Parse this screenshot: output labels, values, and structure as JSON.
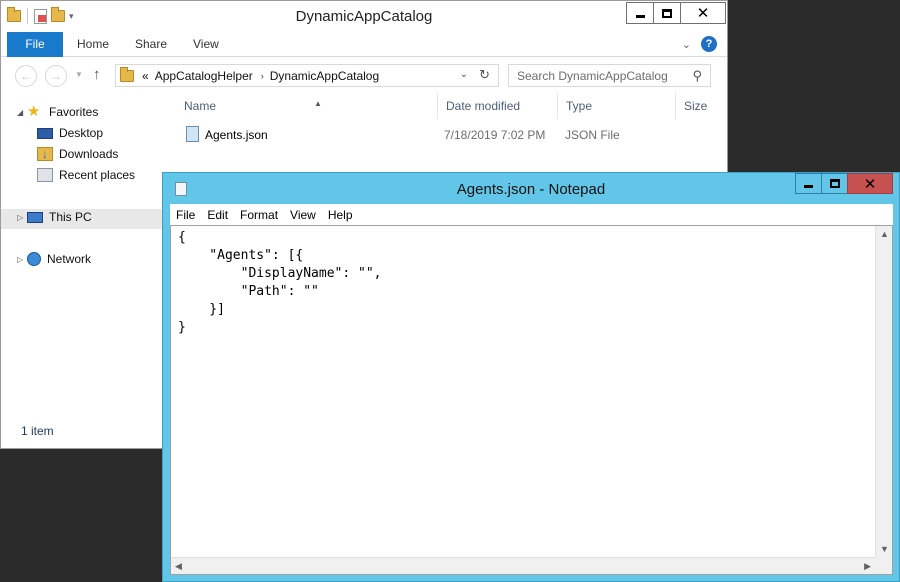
{
  "explorer": {
    "title": "DynamicAppCatalog",
    "tabs": {
      "file": "File",
      "home": "Home",
      "share": "Share",
      "view": "View"
    },
    "help": "?",
    "address": {
      "prefix": "«",
      "crumbs": [
        "AppCatalogHelper",
        "DynamicAppCatalog"
      ],
      "separator": "›"
    },
    "search_placeholder": "Search DynamicAppCatalog",
    "nav": {
      "favorites": "Favorites",
      "desktop": "Desktop",
      "downloads": "Downloads",
      "recent": "Recent places",
      "this_pc": "This PC",
      "network": "Network"
    },
    "columns": {
      "name": "Name",
      "date": "Date modified",
      "type": "Type",
      "size": "Size"
    },
    "files": [
      {
        "name": "Agents.json",
        "date": "7/18/2019 7:02 PM",
        "type": "JSON File",
        "size": ""
      }
    ],
    "status": "1 item"
  },
  "notepad": {
    "title": "Agents.json - Notepad",
    "menu": {
      "file": "File",
      "edit": "Edit",
      "format": "Format",
      "view": "View",
      "help": "Help"
    },
    "content": "{\n    \"Agents\": [{\n        \"DisplayName\": \"\",\n        \"Path\": \"\"\n    }]\n}"
  },
  "icons": {
    "favorites": "star-icon",
    "desktop": "desktop-icon",
    "downloads": "downloads-icon",
    "recent": "recent-places-icon",
    "this_pc": "computer-icon",
    "network": "network-icon",
    "file": "json-file-icon"
  },
  "colors": {
    "file_tab": "#1979ca",
    "notepad_frame": "#61c6e8",
    "close_button": "#c75050"
  }
}
